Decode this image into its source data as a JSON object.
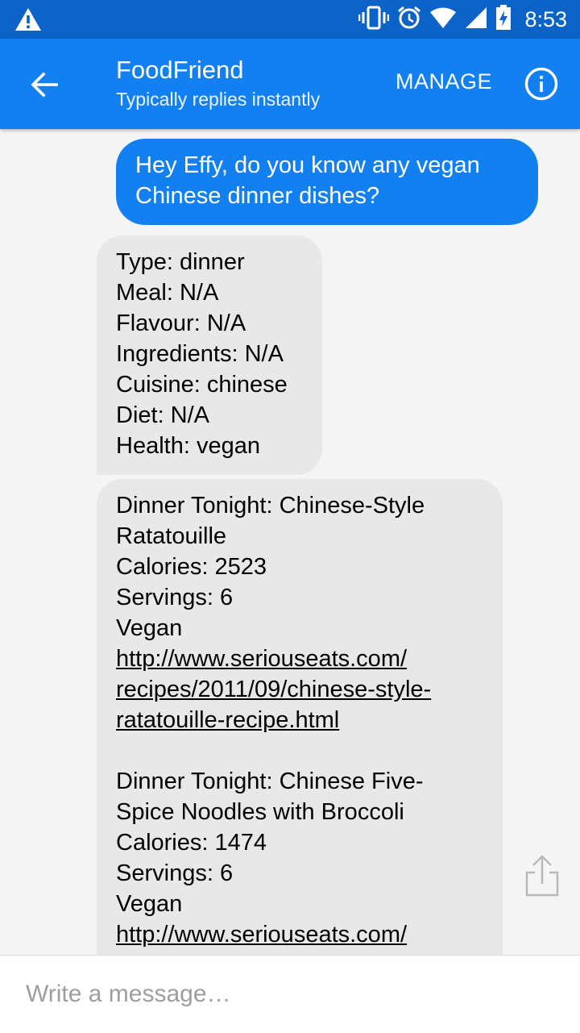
{
  "status_bar": {
    "time": "8:53",
    "icons": [
      "warning-icon",
      "vibrate-icon",
      "alarm-icon",
      "wifi-icon",
      "signal-icon",
      "battery-charging-icon"
    ]
  },
  "header": {
    "title": "FoodFriend",
    "subtitle": "Typically replies instantly",
    "manage_label": "MANAGE",
    "back_icon": "arrow-back-icon",
    "info_icon": "info-icon"
  },
  "messages": {
    "outgoing": "Hey Effy, do you know any vegan Chinese dinner dishes?",
    "filters": [
      "Type: dinner",
      "Meal: N/A",
      "Flavour: N/A",
      "Ingredients: N/A",
      "Cuisine: chinese",
      "Diet: N/A",
      "Health: vegan"
    ],
    "recipes": [
      {
        "title_line1": "Dinner Tonight: Chinese-Style",
        "title_line2": "Ratatouille",
        "calories": "Calories: 2523",
        "servings": "Servings: 6",
        "diet": "Vegan",
        "link_line1": "http://www.seriouseats.com/",
        "link_line2": "recipes/2011/09/chinese-style-",
        "link_line3": "ratatouille-recipe.html"
      },
      {
        "title_line1": "Dinner Tonight: Chinese Five-",
        "title_line2": "Spice Noodles with Broccoli",
        "calories": "Calories: 1474",
        "servings": "Servings: 6",
        "diet": "Vegan",
        "link_line1": "http://www.seriouseats.com/"
      }
    ]
  },
  "composer": {
    "placeholder": "Write a message…",
    "share_icon": "share-icon"
  },
  "colors": {
    "status_bar": "#0c63c7",
    "app_bar": "#1380f2",
    "outgoing_bubble": "#1380f2",
    "incoming_bubble": "#e8e8e8",
    "background": "#f5f5f5"
  }
}
